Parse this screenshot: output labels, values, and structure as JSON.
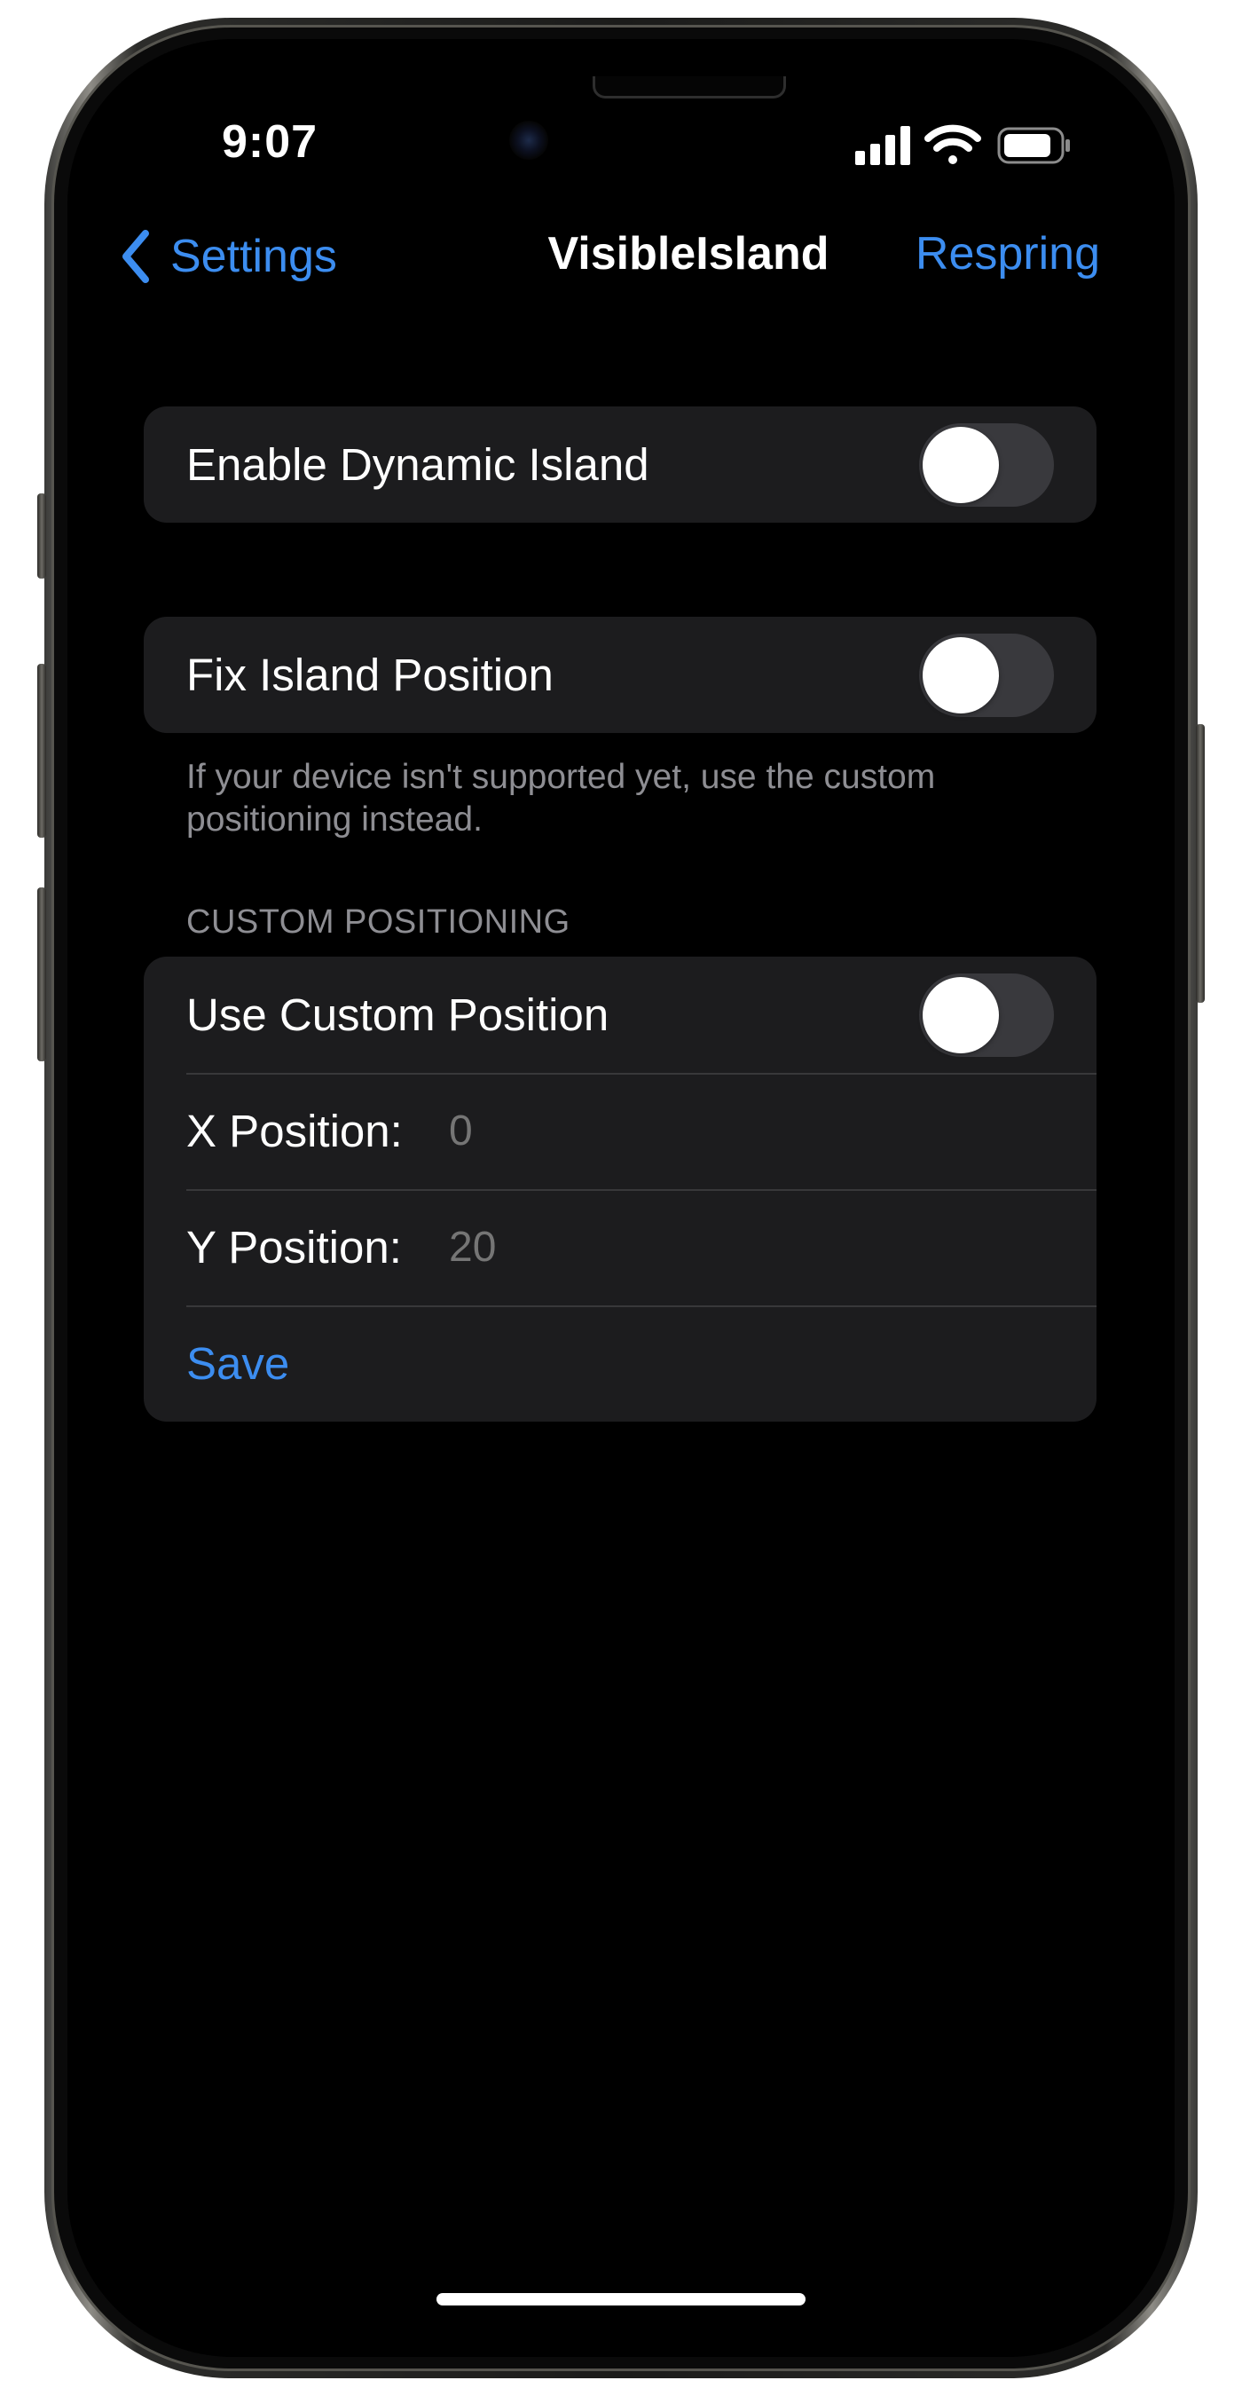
{
  "status_bar": {
    "time": "9:07",
    "icons": [
      "cellular-signal-icon",
      "wifi-icon",
      "battery-icon"
    ]
  },
  "nav": {
    "back_label": "Settings",
    "title": "VisibleIsland",
    "action_label": "Respring"
  },
  "group_dynamic_island": {
    "enable_label": "Enable Dynamic Island",
    "enable_on": false
  },
  "group_fix_position": {
    "fix_label": "Fix Island Position",
    "fix_on": false,
    "footer": "If your device isn't supported yet, use the custom positioning instead."
  },
  "custom_positioning": {
    "header": "CUSTOM POSITIONING",
    "use_custom_label": "Use Custom Position",
    "use_custom_on": false,
    "x_label": "X Position:",
    "x_placeholder": "0",
    "y_label": "Y Position:",
    "y_placeholder": "20",
    "save_label": "Save"
  },
  "colors": {
    "accent": "#3c8df0",
    "background": "#000000",
    "card": "#1c1c1e",
    "secondary_text": "#8e8e93",
    "toggle_off": "#39393d"
  }
}
